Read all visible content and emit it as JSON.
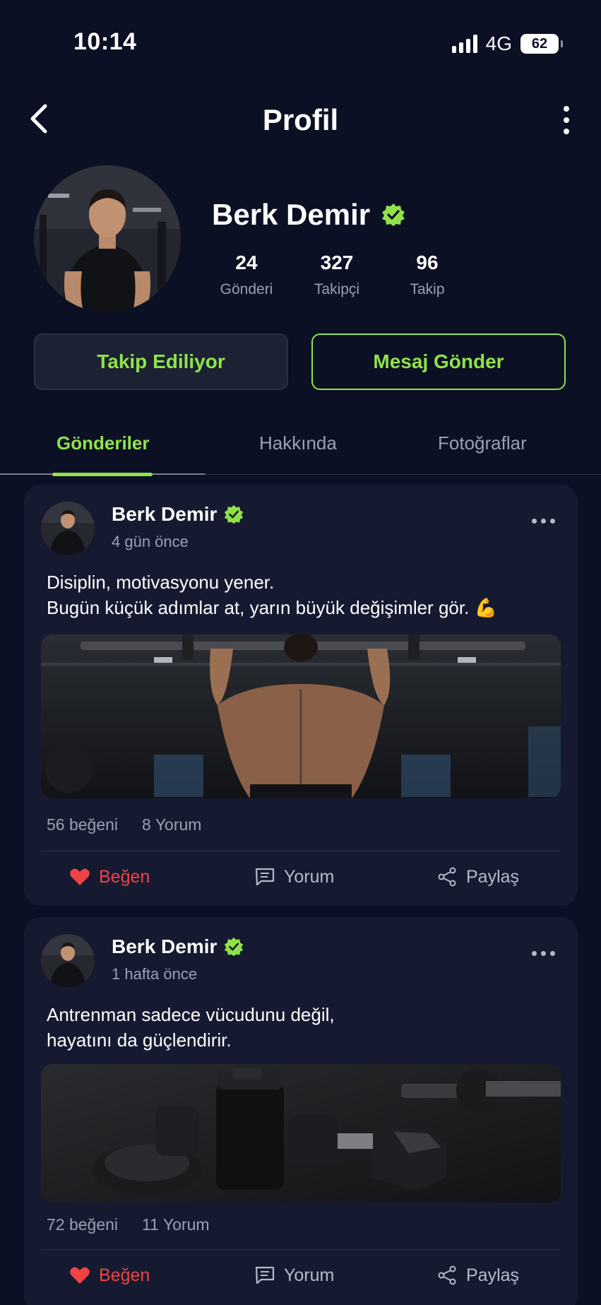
{
  "status_bar": {
    "time": "10:14",
    "network": "4G",
    "battery": "62"
  },
  "nav": {
    "title": "Profil"
  },
  "profile": {
    "name": "Berk Demir",
    "stats": [
      {
        "value": "24",
        "label": "Gönderi"
      },
      {
        "value": "327",
        "label": "Takipçi"
      },
      {
        "value": "96",
        "label": "Takip"
      }
    ],
    "following_button": "Takip Ediliyor",
    "message_button": "Mesaj Gönder"
  },
  "tabs": [
    {
      "label": "Gönderiler",
      "active": true
    },
    {
      "label": "Hakkında",
      "active": false
    },
    {
      "label": "Fotoğraflar",
      "active": false
    }
  ],
  "posts": [
    {
      "author": "Berk Demir",
      "time": "4 gün önce",
      "text_line1": "Disiplin, motivasyonu yener.",
      "text_line2": "Bugün küçük adımlar at, yarın büyük değişimler gör. 💪",
      "likes": "56 beğeni",
      "comments": "8 Yorum",
      "like_label": "Beğen",
      "comment_label": "Yorum",
      "share_label": "Paylaş"
    },
    {
      "author": "Berk Demir",
      "time": "1 hafta önce",
      "text_line1": "Antrenman sadece vücudunu değil,",
      "text_line2": "hayatını da güçlendirir.",
      "likes": "72 beğeni",
      "comments": "11 Yorum",
      "like_label": "Beğen",
      "comment_label": "Yorum",
      "share_label": "Paylaş"
    }
  ],
  "colors": {
    "background": "#0c1024",
    "card": "#161a31",
    "accent": "#8fe34a",
    "like": "#ef4444"
  },
  "icons": [
    "back-chevron-icon",
    "more-vertical-icon",
    "verified-check-icon",
    "more-horizontal-icon",
    "heart-icon",
    "comment-icon",
    "share-icon"
  ]
}
